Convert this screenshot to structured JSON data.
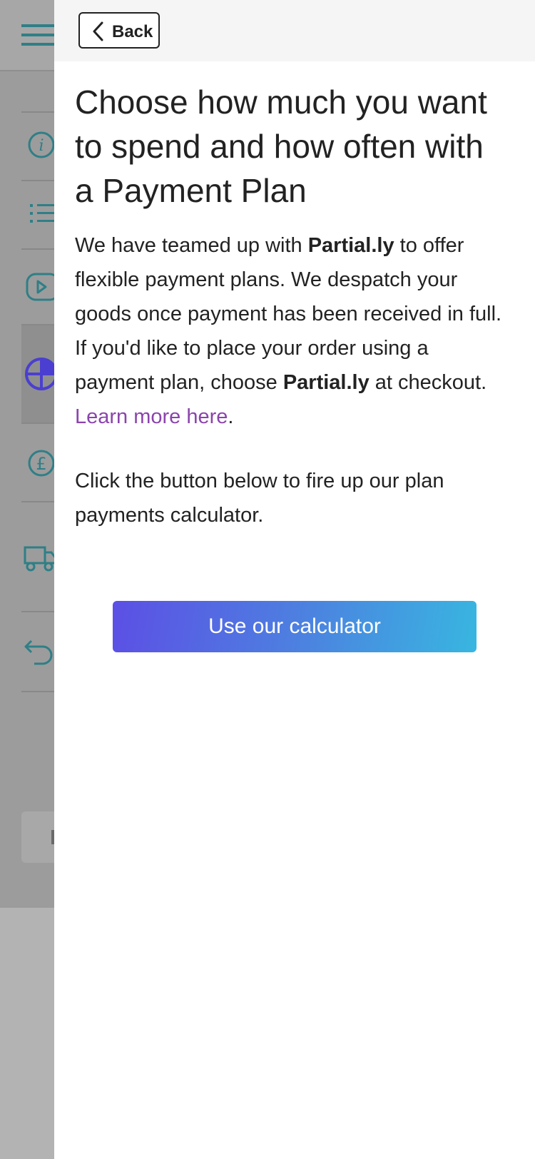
{
  "header": {
    "back_label": "Back"
  },
  "content": {
    "title": "Choose how much you want to spend and how often with a Payment Plan",
    "p1_start": "We have teamed up with ",
    "brand": "Partial.ly",
    "p1_mid": " to offer flexible payment plans. We despatch your goods once payment has been received in full. If you'd like to place your order using a payment plan, choose ",
    "p1_end": " at checkout. ",
    "learn_more": "Learn more here",
    "period": ".",
    "p2": "Click the button below to fire up our plan payments calculator.",
    "calculator_button": "Use our calculator"
  },
  "colors": {
    "link": "#8b44ac",
    "button_gradient_start": "#5c4fe5",
    "button_gradient_end": "#38b6e0",
    "sidebar_icon": "#2f7f86",
    "sidebar_active_icon": "#4a3fd0"
  },
  "sidebar": {
    "icons": [
      "menu-icon",
      "info-icon",
      "list-icon",
      "video-icon",
      "payment-plan-icon",
      "pound-icon",
      "delivery-truck-icon",
      "return-icon"
    ]
  }
}
